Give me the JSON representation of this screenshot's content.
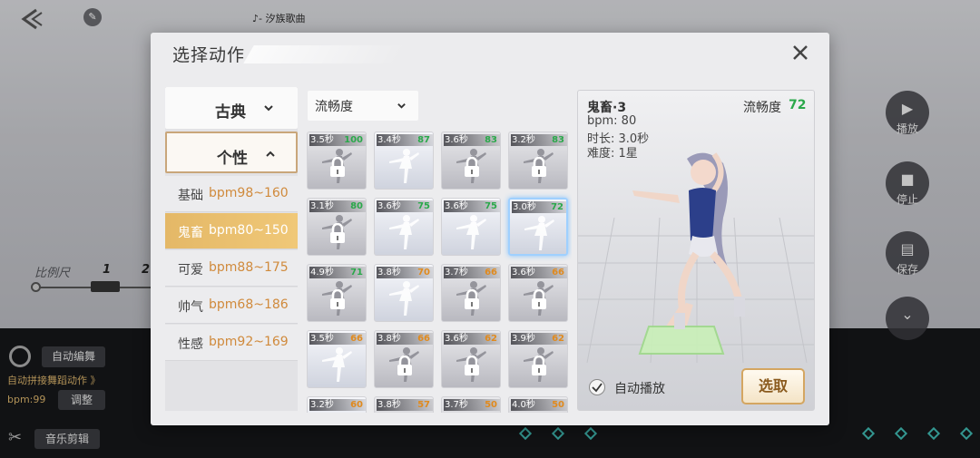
{
  "background": {
    "song_title": "♪- 汐族歌曲",
    "scale_label": "比例尺",
    "scale_ticks": [
      "1",
      "2"
    ],
    "auto_edit_button": "自动编舞",
    "auto_stitch_link": "自动拼接舞蹈动作 》",
    "bpm_text": "bpm:99",
    "adjust_button": "调整",
    "music_cut_button": "音乐剪辑",
    "right_buttons": [
      {
        "label": "播放",
        "icon": "play-icon"
      },
      {
        "label": "停止",
        "icon": "stop-icon"
      },
      {
        "label": "保存",
        "icon": "save-icon"
      },
      {
        "label": "",
        "icon": "chevron-down-icon"
      }
    ]
  },
  "modal": {
    "title": "选择动作",
    "close_icon": "close-icon",
    "categories": [
      {
        "label": "古典",
        "expanded": false
      },
      {
        "label": "个性",
        "expanded": true
      }
    ],
    "subcategories": [
      {
        "name": "基础",
        "bpm": "bpm98~160",
        "active": false
      },
      {
        "name": "鬼畜",
        "bpm": "bpm80~150",
        "active": true
      },
      {
        "name": "可爱",
        "bpm": "bpm88~175",
        "active": false
      },
      {
        "name": "帅气",
        "bpm": "bpm68~186",
        "active": false
      },
      {
        "name": "性感",
        "bpm": "bpm92~169",
        "active": false
      }
    ],
    "filter": {
      "label": "流畅度"
    },
    "cards": [
      {
        "duration": "3.5秒",
        "score": "100",
        "locked": true
      },
      {
        "duration": "3.4秒",
        "score": "87",
        "locked": false
      },
      {
        "duration": "3.6秒",
        "score": "83",
        "locked": true
      },
      {
        "duration": "3.2秒",
        "score": "83",
        "locked": true
      },
      {
        "duration": "3.1秒",
        "score": "80",
        "locked": true
      },
      {
        "duration": "3.6秒",
        "score": "75",
        "locked": false
      },
      {
        "duration": "3.6秒",
        "score": "75",
        "locked": false
      },
      {
        "duration": "3.0秒",
        "score": "72",
        "locked": false,
        "selected": true
      },
      {
        "duration": "4.9秒",
        "score": "71",
        "locked": true
      },
      {
        "duration": "3.8秒",
        "score": "70",
        "locked": false
      },
      {
        "duration": "3.7秒",
        "score": "66",
        "locked": true
      },
      {
        "duration": "3.6秒",
        "score": "66",
        "locked": true
      },
      {
        "duration": "3.5秒",
        "score": "66",
        "locked": false
      },
      {
        "duration": "3.8秒",
        "score": "66",
        "locked": true
      },
      {
        "duration": "3.6秒",
        "score": "62",
        "locked": true
      },
      {
        "duration": "3.9秒",
        "score": "62",
        "locked": true
      },
      {
        "duration": "3.2秒",
        "score": "60",
        "locked": false
      },
      {
        "duration": "3.8秒",
        "score": "57",
        "locked": true
      },
      {
        "duration": "3.7秒",
        "score": "50",
        "locked": true
      },
      {
        "duration": "4.0秒",
        "score": "50",
        "locked": true
      }
    ],
    "preview": {
      "name": "鬼畜·3",
      "score_label": "流畅度",
      "score": "72",
      "bpm": "bpm: 80",
      "duration": "时长: 3.0秒",
      "difficulty": "难度: 1星",
      "autoplay_label": "自动播放",
      "autoplay_checked": true,
      "select_button": "选取"
    }
  },
  "colors": {
    "accent_gold": "#e4b867",
    "score_green": "#2aa84a",
    "score_orange": "#e08a1e",
    "bpm_orange": "#d08a3c"
  }
}
